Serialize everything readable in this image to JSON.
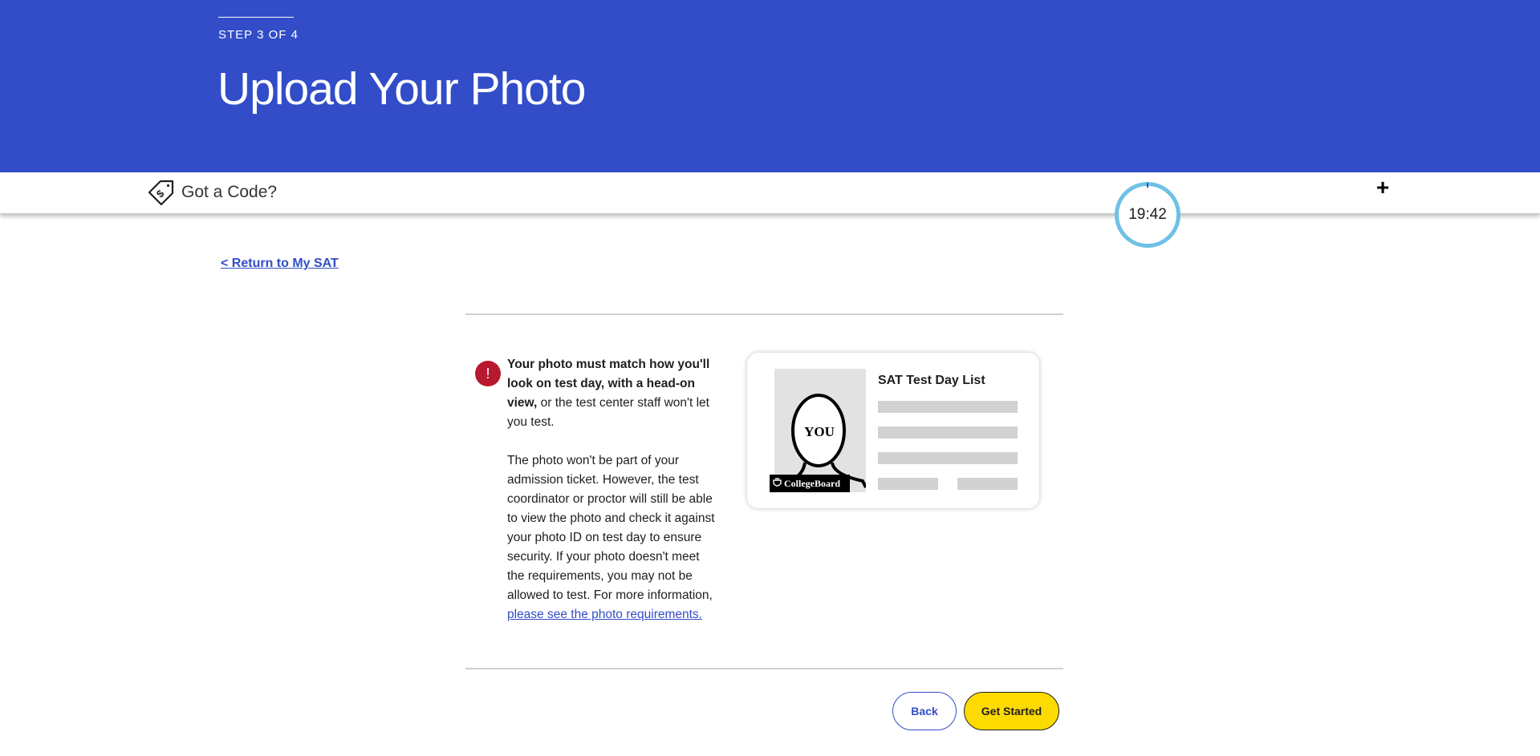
{
  "header": {
    "step": "STEP 3 OF 4",
    "title": "Upload Your Photo",
    "background_color": "#324dc7"
  },
  "code_bar": {
    "label": "Got a Code?",
    "icon": "price-tag-dollar-icon",
    "expand_icon": "plus-icon"
  },
  "timer": {
    "value": "19:42",
    "ring_color": "#6ec0e6"
  },
  "nav": {
    "return_link": "< Return to My SAT"
  },
  "notice": {
    "alert_symbol": "!",
    "alert_color": "#b7192f",
    "bold_text": "Your photo must match how you'll look on test day, with a head-on view,",
    "rest_text": " or the test center staff won't let you test.",
    "body": "The photo won't be part of your admission ticket. However, the test coordinator or proctor will still be able to view the photo and check it against your photo ID on test day to ensure security. If your photo doesn't meet the requirements, you may not be allowed to test. For more information, ",
    "link": "please see the photo requirements."
  },
  "ticket_card": {
    "photo_label": "YOU",
    "brand": "CollegeBoard",
    "title": "SAT Test Day List"
  },
  "actions": {
    "back": "Back",
    "start": "Get Started",
    "start_color": "#fedb00"
  }
}
